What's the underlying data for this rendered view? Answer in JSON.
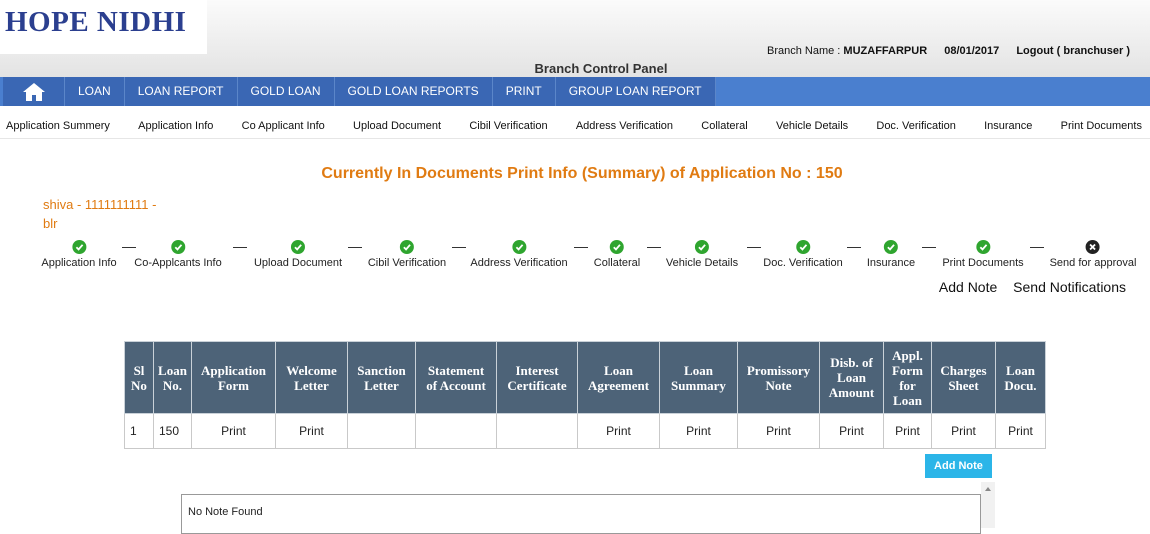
{
  "brand": {
    "logo": "HOPE NIDHI"
  },
  "header": {
    "branch_label": "Branch Name : ",
    "branch_name": "MUZAFFARPUR",
    "date": "08/01/2017",
    "logout": "Logout ( branchuser )",
    "panel_title": "Branch Control Panel"
  },
  "main_nav": {
    "home_icon": "home-icon",
    "items": [
      {
        "label": "LOAN"
      },
      {
        "label": "LOAN REPORT"
      },
      {
        "label": "GOLD LOAN"
      },
      {
        "label": "GOLD LOAN REPORTS"
      },
      {
        "label": "PRINT"
      },
      {
        "label": "GROUP LOAN REPORT"
      }
    ]
  },
  "sub_nav": [
    "Application Summery",
    "Application Info",
    "Co Applicant Info",
    "Upload Document",
    "Cibil Verification",
    "Address Verification",
    "Collateral",
    "Vehicle Details",
    "Doc. Verification",
    "Insurance",
    "Print Documents"
  ],
  "page": {
    "heading": "Currently In Documents Print Info (Summary) of Application No : 150",
    "applicant_line1": "shiva - 1111111111 -",
    "applicant_line2": "blr"
  },
  "steps": [
    {
      "label": "Application Info",
      "status": "done"
    },
    {
      "label": "Co-Applcants Info",
      "status": "done"
    },
    {
      "label": "Upload Document",
      "status": "done"
    },
    {
      "label": "Cibil Verification",
      "status": "done"
    },
    {
      "label": "Address Verification",
      "status": "done"
    },
    {
      "label": "Collateral",
      "status": "done"
    },
    {
      "label": "Vehicle Details",
      "status": "done"
    },
    {
      "label": "Doc. Verification",
      "status": "done"
    },
    {
      "label": "Insurance",
      "status": "done"
    },
    {
      "label": "Print Documents",
      "status": "done"
    },
    {
      "label": "Send for approval",
      "status": "pending"
    }
  ],
  "actions": {
    "add_note": "Add Note",
    "send_notifications": "Send Notifications"
  },
  "table": {
    "headers": [
      [
        "Sl",
        "No"
      ],
      [
        "Loan",
        "No."
      ],
      [
        "Application",
        "Form"
      ],
      [
        "Welcome",
        "Letter"
      ],
      [
        "Sanction",
        "Letter"
      ],
      [
        "Statement",
        "of Account"
      ],
      [
        "Interest",
        "Certificate"
      ],
      [
        "Loan",
        "Agreement"
      ],
      [
        "Loan",
        "Summary"
      ],
      [
        "Promissory",
        "Note"
      ],
      [
        "Disb. of",
        "Loan",
        "Amount"
      ],
      [
        "Appl.",
        "Form",
        "for",
        "Loan"
      ],
      [
        "Charges",
        "Sheet"
      ],
      [
        "Loan",
        "Docu."
      ]
    ],
    "rows": [
      [
        "1",
        "150",
        "Print",
        "Print",
        "",
        "",
        "",
        "Print",
        "Print",
        "Print",
        "Print",
        "Print",
        "Print",
        "Print"
      ]
    ]
  },
  "notes": {
    "add_button": "Add Note",
    "empty_text": "No Note Found"
  },
  "colors": {
    "accent_orange": "#e07b12",
    "nav_blue": "#4a7fcf",
    "table_header": "#4d6378",
    "button_cyan": "#2bb5e8"
  }
}
